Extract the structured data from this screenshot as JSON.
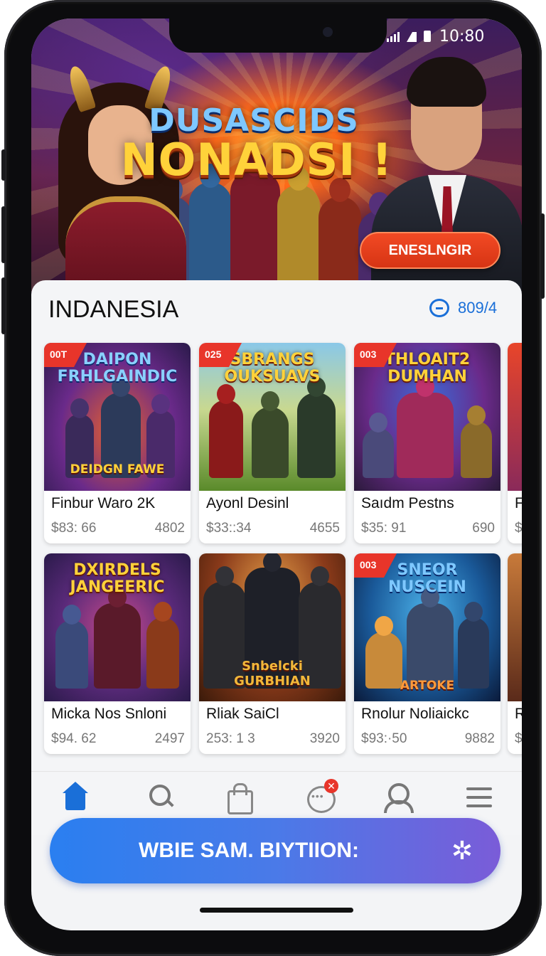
{
  "status_bar": {
    "time": "10:80"
  },
  "hero": {
    "title_line1": "DUSASCIDS",
    "title_line2": "NONADSI !",
    "cta_label": "ENESLNGIR"
  },
  "section": {
    "title": "INDANESIA",
    "meta_count": "809/4"
  },
  "games": [
    {
      "badge": "00T",
      "art_title": "DAIPON FRHLGAINDIC",
      "art_sub": "DEIDGN FAWE",
      "name": "Finbur Waro 2K",
      "price": "$83: 66",
      "count": "4802"
    },
    {
      "badge": "025",
      "art_title": "SBRANGS OUKSUAVS",
      "art_sub": "",
      "name": "Ayonl Desinl",
      "price": "$33::34",
      "count": "4655"
    },
    {
      "badge": "003",
      "art_title": "THLOAIT2 DUMHAN",
      "art_sub": "",
      "name": "Saıdm Pestns",
      "price": "$35: 91",
      "count": "690"
    },
    {
      "badge": "",
      "art_title": "",
      "art_sub": "",
      "name": "F",
      "price": "$",
      "count": ""
    },
    {
      "badge": "",
      "art_title": "DXIRDELS JANGEERIC",
      "art_sub": "",
      "name": "Micka Nos Snloni",
      "price": "$94. 62",
      "count": "2497"
    },
    {
      "badge": "",
      "art_title": "",
      "art_sub": "Snbelcki GURBHIAN",
      "name": "Rliak SaiCl",
      "price": "253: 1 3",
      "count": "3920"
    },
    {
      "badge": "003",
      "art_title": "SNEOR NUSCEIN",
      "art_sub": "ARTOKE",
      "name": "Rnolur Noliaickc",
      "price": "$93:·50",
      "count": "9882"
    },
    {
      "badge": "",
      "art_title": "",
      "art_sub": "",
      "name": "R",
      "price": "$",
      "count": ""
    }
  ],
  "bottom_nav": {
    "items": [
      "home",
      "search",
      "bag",
      "chat",
      "user",
      "menu"
    ],
    "notif_badge": "✕"
  },
  "promo": {
    "label": "WBIE SAM. BIYTIION:"
  },
  "colors": {
    "accent": "#1a6fd8",
    "badge_red": "#e8352a",
    "cta_orange": "#e63c1a"
  }
}
